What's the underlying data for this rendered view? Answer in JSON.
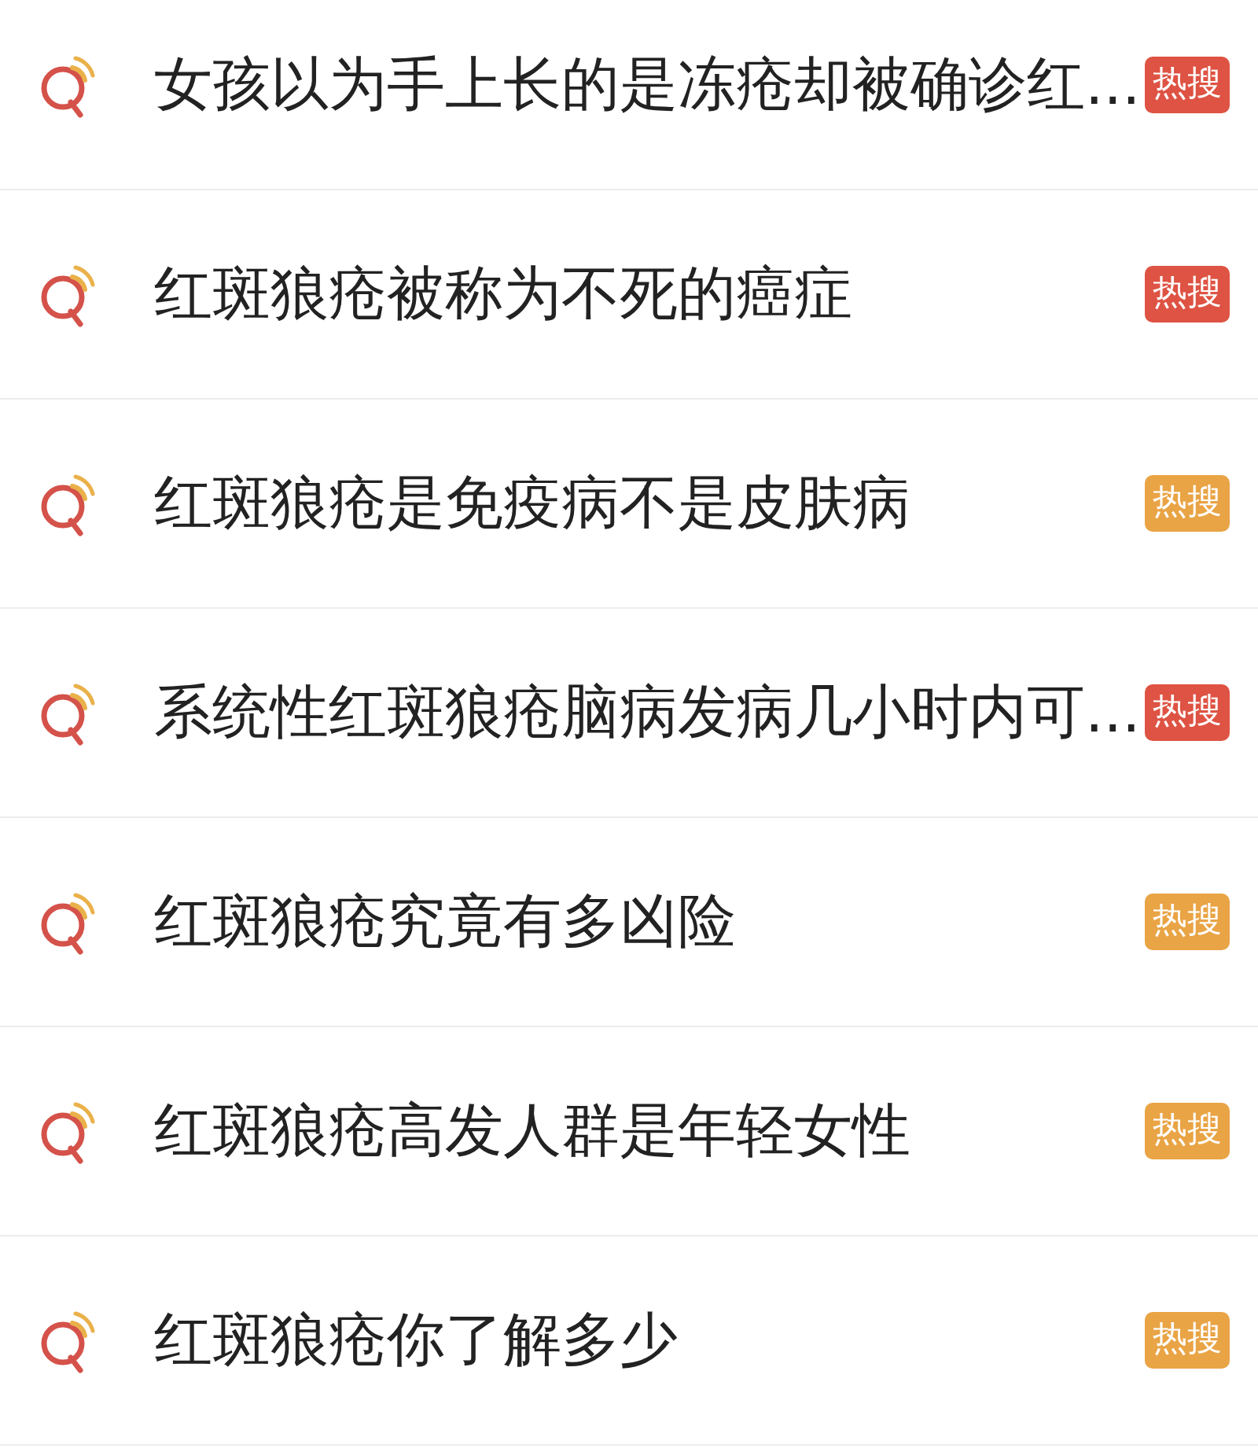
{
  "results": [
    {
      "text": "女孩以为手上长的是冻疮却被确诊红...",
      "badge": "热搜",
      "color": "#de5343"
    },
    {
      "text": "红斑狼疮被称为不死的癌症",
      "badge": "热搜",
      "color": "#de5343"
    },
    {
      "text": "红斑狼疮是免疫病不是皮肤病",
      "badge": "热搜",
      "color": "#e9a445"
    },
    {
      "text": "系统性红斑狼疮脑病发病几小时内可...",
      "badge": "热搜",
      "color": "#de5343"
    },
    {
      "text": "红斑狼疮究竟有多凶险",
      "badge": "热搜",
      "color": "#e9a445"
    },
    {
      "text": "红斑狼疮高发人群是年轻女性",
      "badge": "热搜",
      "color": "#e9a445"
    },
    {
      "text": "红斑狼疮你了解多少",
      "badge": "热搜",
      "color": "#e9a445"
    }
  ]
}
